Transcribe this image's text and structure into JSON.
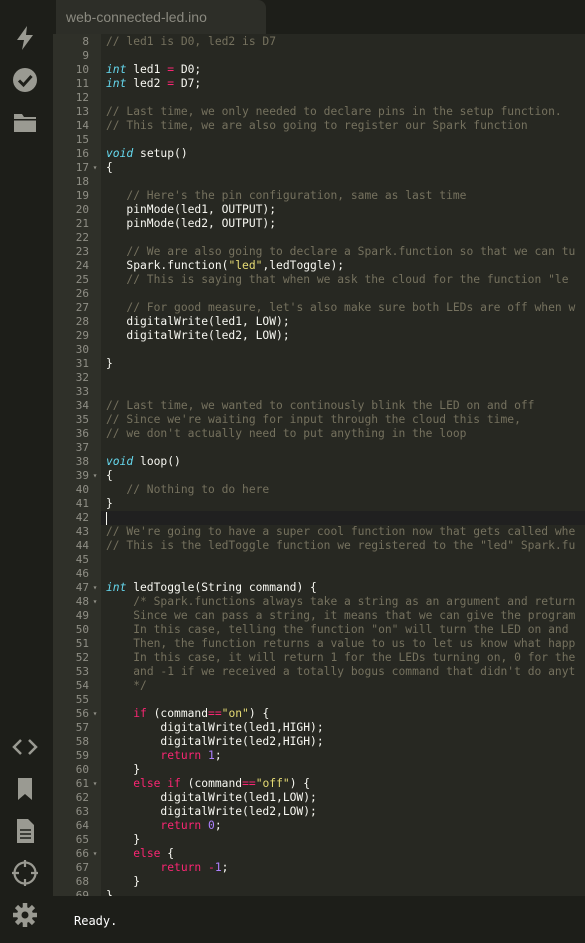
{
  "tab": {
    "filename": "web-connected-led.ino"
  },
  "status": {
    "text": "Ready."
  },
  "sidebar": {
    "top": [
      {
        "name": "flash-icon"
      },
      {
        "name": "verify-icon"
      },
      {
        "name": "files-icon"
      }
    ],
    "bottom": [
      {
        "name": "code-icon"
      },
      {
        "name": "libraries-icon"
      },
      {
        "name": "docs-icon"
      },
      {
        "name": "devices-icon"
      },
      {
        "name": "settings-icon"
      }
    ]
  },
  "editor": {
    "current_line": 42,
    "lines": [
      {
        "n": "8",
        "fold": false,
        "code": "[[c:// led1 is D0, led2 is D7]]"
      },
      {
        "n": "9",
        "fold": false,
        "code": ""
      },
      {
        "n": "10",
        "fold": false,
        "code": "[[t:int]] led1 [[o:=]] D0;"
      },
      {
        "n": "11",
        "fold": false,
        "code": "[[t:int]] led2 [[o:=]] D7;"
      },
      {
        "n": "12",
        "fold": false,
        "code": ""
      },
      {
        "n": "13",
        "fold": false,
        "code": "[[c:// Last time, we only needed to declare pins in the setup function.]]"
      },
      {
        "n": "14",
        "fold": false,
        "code": "[[c:// This time, we are also going to register our Spark function]]"
      },
      {
        "n": "15",
        "fold": false,
        "code": ""
      },
      {
        "n": "16",
        "fold": false,
        "code": "[[t:void]] setup()"
      },
      {
        "n": "17",
        "fold": true,
        "code": "{"
      },
      {
        "n": "18",
        "fold": false,
        "code": ""
      },
      {
        "n": "19",
        "fold": false,
        "code": "   [[c:// Here's the pin configuration, same as last time]]"
      },
      {
        "n": "20",
        "fold": false,
        "code": "   pinMode(led1, OUTPUT);"
      },
      {
        "n": "21",
        "fold": false,
        "code": "   pinMode(led2, OUTPUT);"
      },
      {
        "n": "22",
        "fold": false,
        "code": ""
      },
      {
        "n": "23",
        "fold": false,
        "code": "   [[c:// We are also going to declare a Spark.function so that we can tu]]"
      },
      {
        "n": "24",
        "fold": false,
        "code": "   Spark.function([[s:\"led\"]],ledToggle);"
      },
      {
        "n": "25",
        "fold": false,
        "code": "   [[c:// This is saying that when we ask the cloud for the function \"le]]"
      },
      {
        "n": "26",
        "fold": false,
        "code": ""
      },
      {
        "n": "27",
        "fold": false,
        "code": "   [[c:// For good measure, let's also make sure both LEDs are off when w]]"
      },
      {
        "n": "28",
        "fold": false,
        "code": "   digitalWrite(led1, LOW);"
      },
      {
        "n": "29",
        "fold": false,
        "code": "   digitalWrite(led2, LOW);"
      },
      {
        "n": "30",
        "fold": false,
        "code": ""
      },
      {
        "n": "31",
        "fold": false,
        "code": "}"
      },
      {
        "n": "32",
        "fold": false,
        "code": ""
      },
      {
        "n": "33",
        "fold": false,
        "code": ""
      },
      {
        "n": "34",
        "fold": false,
        "code": "[[c:// Last time, we wanted to continously blink the LED on and off]]"
      },
      {
        "n": "35",
        "fold": false,
        "code": "[[c:// Since we're waiting for input through the cloud this time,]]"
      },
      {
        "n": "36",
        "fold": false,
        "code": "[[c:// we don't actually need to put anything in the loop]]"
      },
      {
        "n": "37",
        "fold": false,
        "code": ""
      },
      {
        "n": "38",
        "fold": false,
        "code": "[[t:void]] loop()"
      },
      {
        "n": "39",
        "fold": true,
        "code": "{"
      },
      {
        "n": "40",
        "fold": false,
        "code": "   [[c:// Nothing to do here]]"
      },
      {
        "n": "41",
        "fold": false,
        "code": "}"
      },
      {
        "n": "42",
        "fold": false,
        "code": ""
      },
      {
        "n": "43",
        "fold": false,
        "code": "[[c:// We're going to have a super cool function now that gets called whe]]"
      },
      {
        "n": "44",
        "fold": false,
        "code": "[[c:// This is the ledToggle function we registered to the \"led\" Spark.fu]]"
      },
      {
        "n": "45",
        "fold": false,
        "code": ""
      },
      {
        "n": "46",
        "fold": false,
        "code": ""
      },
      {
        "n": "47",
        "fold": true,
        "code": "[[t:int]] ledToggle(String command) {"
      },
      {
        "n": "48",
        "fold": true,
        "code": "    [[c:/* Spark.functions always take a string as an argument and return]]"
      },
      {
        "n": "49",
        "fold": false,
        "code": "    [[c:Since we can pass a string, it means that we can give the program]]"
      },
      {
        "n": "50",
        "fold": false,
        "code": "    [[c:In this case, telling the function \"on\" will turn the LED on and]]"
      },
      {
        "n": "51",
        "fold": false,
        "code": "    [[c:Then, the function returns a value to us to let us know what happ]]"
      },
      {
        "n": "52",
        "fold": false,
        "code": "    [[c:In this case, it will return 1 for the LEDs turning on, 0 for the]]"
      },
      {
        "n": "53",
        "fold": false,
        "code": "    [[c:and -1 if we received a totally bogus command that didn't do anyt]]"
      },
      {
        "n": "54",
        "fold": false,
        "code": "    [[c:*/]]"
      },
      {
        "n": "55",
        "fold": false,
        "code": ""
      },
      {
        "n": "56",
        "fold": true,
        "code": "    [[k:if]] (command[[o:==]][[s:\"on\"]]) {"
      },
      {
        "n": "57",
        "fold": false,
        "code": "        digitalWrite(led1,HIGH);"
      },
      {
        "n": "58",
        "fold": false,
        "code": "        digitalWrite(led2,HIGH);"
      },
      {
        "n": "59",
        "fold": false,
        "code": "        [[k:return]] [[n:1]];"
      },
      {
        "n": "60",
        "fold": false,
        "code": "    }"
      },
      {
        "n": "61",
        "fold": true,
        "code": "    [[k:else]] [[k:if]] (command[[o:==]][[s:\"off\"]]) {"
      },
      {
        "n": "62",
        "fold": false,
        "code": "        digitalWrite(led1,LOW);"
      },
      {
        "n": "63",
        "fold": false,
        "code": "        digitalWrite(led2,LOW);"
      },
      {
        "n": "64",
        "fold": false,
        "code": "        [[k:return]] [[n:0]];"
      },
      {
        "n": "65",
        "fold": false,
        "code": "    }"
      },
      {
        "n": "66",
        "fold": true,
        "code": "    [[k:else]] {"
      },
      {
        "n": "67",
        "fold": false,
        "code": "        [[k:return]] [[o:-]][[n:1]];"
      },
      {
        "n": "68",
        "fold": false,
        "code": "    }"
      },
      {
        "n": "69",
        "fold": false,
        "code": "}"
      }
    ]
  }
}
